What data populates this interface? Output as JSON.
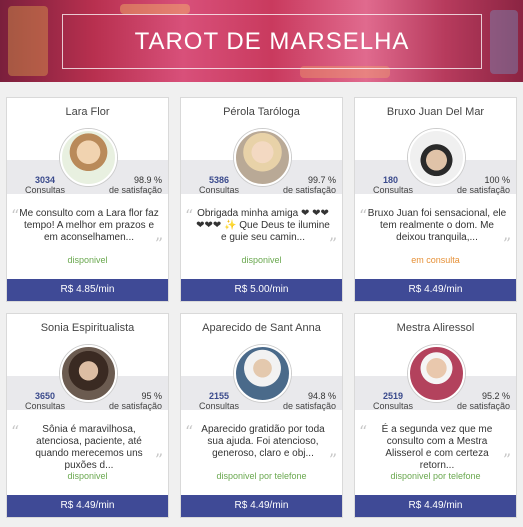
{
  "banner": {
    "title": "TAROT DE MARSELHA"
  },
  "labels": {
    "consultas": "Consultas",
    "satisfacao": "de satisfação"
  },
  "colors": {
    "available": "#6aa84f",
    "busy": "#e69138",
    "price_bar": "#3f4a96"
  },
  "cards": [
    {
      "name": "Lara Flor",
      "count": "3034",
      "satisfaction": "98.9 %",
      "quote": "Me consulto com a Lara flor faz tempo! A melhor em prazos e em aconselhamen...",
      "status": "disponivel",
      "status_type": "available",
      "price": "R$ 4.85/min",
      "avatar": "avatar-lara"
    },
    {
      "name": "Pérola Taróloga",
      "count": "5386",
      "satisfaction": "99.7 %",
      "quote": "Obrigada minha amiga ❤ ❤❤❤❤❤ ✨ Que Deus te ilumine e guie seu camin...",
      "status": "disponivel",
      "status_type": "available",
      "price": "R$ 5.00/min",
      "avatar": "avatar-perola"
    },
    {
      "name": "Bruxo Juan Del Mar",
      "count": "180",
      "satisfaction": "100 %",
      "quote": "Bruxo Juan foi sensacional, ele tem realmente o dom. Me deixou tranquila,...",
      "status": "em consulta",
      "status_type": "busy",
      "price": "R$ 4.49/min",
      "avatar": "avatar-juan"
    },
    {
      "name": "Sonia Espiritualista",
      "count": "3650",
      "satisfaction": "95 %",
      "quote": "Sônia é maravilhosa, atenciosa, paciente, até quando merecemos uns puxões d...",
      "status": "disponivel",
      "status_type": "available",
      "price": "R$ 4.49/min",
      "avatar": "avatar-sonia"
    },
    {
      "name": "Aparecido de Sant Anna",
      "count": "2155",
      "satisfaction": "94.8 %",
      "quote": "Aparecido gratidão por toda sua ajuda. Foi atencioso, generoso, claro e obj...",
      "status": "disponivel por telefone",
      "status_type": "available",
      "price": "R$ 4.49/min",
      "avatar": "avatar-aparecido"
    },
    {
      "name": "Mestra Aliressol",
      "count": "2519",
      "satisfaction": "95.2 %",
      "quote": "É a segunda vez que me consulto com a Mestra Alisserol e com certeza retorn...",
      "status": "disponivel por telefone",
      "status_type": "available",
      "price": "R$ 4.49/min",
      "avatar": "avatar-aliressol"
    }
  ]
}
